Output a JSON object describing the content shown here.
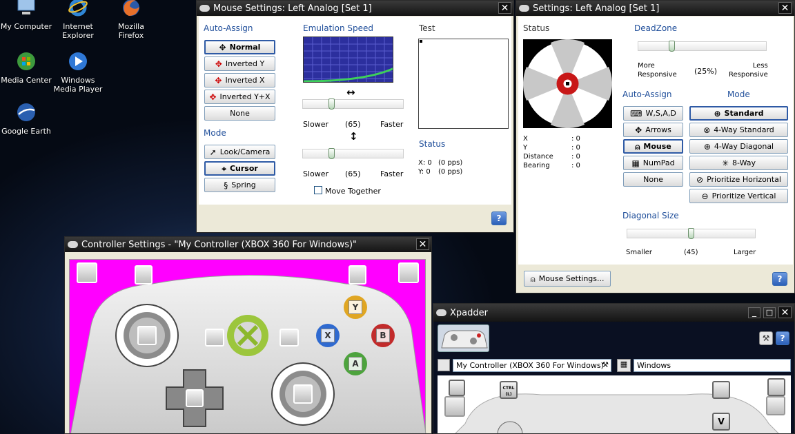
{
  "desktop": {
    "icons": [
      {
        "label": "My Computer"
      },
      {
        "label": "Internet Explorer"
      },
      {
        "label": "Mozilla Firefox"
      },
      {
        "label": "Media Center"
      },
      {
        "label": "Windows Media Player"
      },
      {
        "label": "Google Earth"
      }
    ]
  },
  "mouse_win": {
    "title": "Mouse Settings: Left Analog [Set 1]",
    "auto_assign": "Auto-Assign",
    "aa": [
      "Normal",
      "Inverted Y",
      "Inverted X",
      "Inverted Y+X",
      "None"
    ],
    "mode": "Mode",
    "modes": [
      "Look/Camera",
      "Cursor",
      "Spring"
    ],
    "emu": "Emulation Speed",
    "h_arrow": "↔",
    "v_arrow": "↕",
    "slower": "Slower",
    "faster": "Faster",
    "speed1": "(65)",
    "speed2": "(65)",
    "speed1_fraction": 0.27,
    "speed2_fraction": 0.27,
    "move_together": "Move Together",
    "test": "Test",
    "status": "Status",
    "x_label": "X: 0",
    "x_pps": "(0 pps)",
    "y_label": "Y: 0",
    "y_pps": "(0 pps)",
    "help": "?"
  },
  "analog_win": {
    "title": "Settings: Left Analog [Set 1]",
    "status": "Status",
    "deadzone": "DeadZone",
    "deadzone_fraction": 0.25,
    "more": "More",
    "more2": "Responsive",
    "dz_val": "(25%)",
    "less": "Less",
    "less2": "Responsive",
    "info": [
      [
        "X",
        ": 0"
      ],
      [
        "Y",
        ": 0"
      ],
      [
        "Distance",
        ": 0"
      ],
      [
        "Bearing",
        ": 0"
      ]
    ],
    "auto_assign": "Auto-Assign",
    "mode": "Mode",
    "aa": [
      "W,S,A,D",
      "Arrows",
      "Mouse",
      "NumPad",
      "None"
    ],
    "modes": [
      "Standard",
      "4-Way Standard",
      "4-Way Diagonal",
      "8-Way",
      "Prioritize Horizontal",
      "Prioritize Vertical"
    ],
    "diag": "Diagonal Size",
    "smaller": "Smaller",
    "diag_val": "(45)",
    "larger": "Larger",
    "diag_fraction": 0.5,
    "mouse_settings": "Mouse Settings...",
    "help": "?"
  },
  "ctrl_win": {
    "title": "Controller Settings - \"My Controller (XBOX 360 For Windows)\""
  },
  "xpadder": {
    "title": "Xpadder",
    "controller": "My Controller (XBOX 360 For Windows)",
    "profile": "Windows",
    "help": "?",
    "keys": [
      "CTRL (L)",
      "V"
    ]
  },
  "close": "✕",
  "colors": {
    "accent": "#1f4e9a",
    "magenta": "#ff00ff",
    "titlebar": "#1e1e1e"
  }
}
